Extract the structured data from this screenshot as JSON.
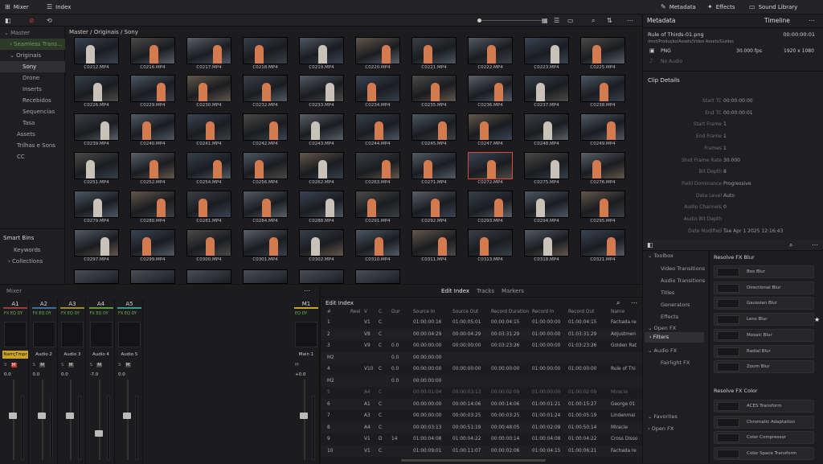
{
  "topbar": {
    "mixer": "Mixer",
    "index": "Index",
    "metadata": "Metadata",
    "effects": "Effects",
    "sound_library": "Sound Library"
  },
  "right_header": {
    "metadata": "Metadata",
    "timeline": "Timeline"
  },
  "left_tree": [
    "Master",
    "Seamless Trans...",
    "Originais",
    "Sony",
    "Drone",
    "Inserts",
    "Recebidos",
    "Sequencias",
    "Tasa",
    "Assets",
    "Trilhas e Sons",
    "CC"
  ],
  "smart_bins": {
    "title": "Smart Bins",
    "items": [
      "Keywords",
      "Collections"
    ]
  },
  "breadcrumb": "Master / Originais / Sony",
  "clips": [
    [
      "C0212.MP4",
      "C0216.MP4",
      "C0217.MP4",
      "C0218.MP4",
      "C0219.MP4",
      "C0220.MP4",
      "C0221.MP4",
      "C0222.MP4",
      "C0223.MP4",
      "C0225.MP4"
    ],
    [
      "C0226.MP4",
      "C0229.MP4",
      "C0230.MP4",
      "C0232.MP4",
      "C0233.MP4",
      "C0234.MP4",
      "C0235.MP4",
      "C0236.MP4",
      "C0237.MP4",
      "C0238.MP4"
    ],
    [
      "C0239.MP4",
      "C0240.MP4",
      "C0241.MP4",
      "C0242.MP4",
      "C0243.MP4",
      "C0244.MP4",
      "C0245.MP4",
      "C0247.MP4",
      "C0248.MP4",
      "C0249.MP4"
    ],
    [
      "C0251.MP4",
      "C0252.MP4",
      "C0254.MP4",
      "C0256.MP4",
      "C0262.MP4",
      "C0263.MP4",
      "C0271.MP4",
      "C0272.MP4",
      "C0275.MP4",
      "C0276.MP4"
    ],
    [
      "C0279.MP4",
      "C0280.MP4",
      "C0281.MP4",
      "C0284.MP4",
      "C0288.MP4",
      "C0291.MP4",
      "C0292.MP4",
      "C0293.MP4",
      "C0294.MP4",
      "C0295.MP4"
    ],
    [
      "C0297.MP4",
      "C0299.MP4",
      "C0300.MP4",
      "C0301.MP4",
      "C0302.MP4",
      "C0310.MP4",
      "C0311.MP4",
      "C0313.MP4",
      "C0318.MP4",
      "C0321.MP4"
    ]
  ],
  "metadata": {
    "filename": "Rule of Thirds-01.png",
    "timecode": "00:00:00:01",
    "path": "/mnt/Produção/Assets/Video Assets/Guides",
    "codec": "PNG",
    "fps": "30.000 fps",
    "resolution": "1920 x 1080",
    "audio": "No Audio",
    "section": "Clip Details",
    "details": [
      [
        "Start TC",
        "00:00:00:00"
      ],
      [
        "End TC",
        "00:00:00:01"
      ],
      [
        "Start Frame",
        "1"
      ],
      [
        "End Frame",
        "1"
      ],
      [
        "Frames",
        "1"
      ],
      [
        "Shot Frame Rate",
        "30.000"
      ],
      [
        "Bit Depth",
        "8"
      ],
      [
        "Field Dominance",
        "Progressive"
      ],
      [
        "Data Level",
        "Auto"
      ],
      [
        "Audio Channels",
        "0"
      ],
      [
        "Audio Bit Depth",
        ""
      ],
      [
        "Date Modified",
        "Tue Apr 1 2025 12:16:43"
      ]
    ]
  },
  "fx_tree": [
    "Toolbox",
    "Video Transitions",
    "Audio Transitions",
    "Titles",
    "Generators",
    "Effects",
    "Open FX",
    "Filters",
    "Audio FX",
    "Fairlight FX",
    "Favorites",
    "Open FX"
  ],
  "fx_blur": {
    "title": "Resolve FX Blur",
    "items": [
      "Box Blur",
      "Directional Blur",
      "Gaussian Blur",
      "Lens Blur",
      "Mosaic Blur",
      "Radial Blur",
      "Zoom Blur"
    ]
  },
  "fx_color": {
    "title": "Resolve FX Color",
    "items": [
      "ACES Transform",
      "Chromatic Adaptation",
      "Color Compressor",
      "Color Space Transform"
    ]
  },
  "mixer": {
    "title": "Mixer",
    "tracks": [
      "A1",
      "A2",
      "A3",
      "A4",
      "A5"
    ],
    "names": [
      "NarrçTmpr",
      "Audio 2",
      "Audio 3",
      "Audio 4",
      "Audio 5"
    ],
    "levels": [
      "0.0",
      "0.0",
      "0.0",
      "-7.0",
      "0.0"
    ],
    "main": "M1",
    "main_name": "Main 1",
    "main_level": "+0.0"
  },
  "edit_tabs": [
    "Edit Index",
    "Tracks",
    "Markers"
  ],
  "edit_title": "Edit Index",
  "edit_cols": [
    "#",
    "Reel",
    "V",
    "C",
    "Dur",
    "Source In",
    "Source Out",
    "Record Duration",
    "Record In",
    "Record Out",
    "Name"
  ],
  "edit_rows": [
    [
      "1",
      "",
      "V1",
      "C",
      "",
      "01:00:00:16",
      "01:00:05:01",
      "00:00:04:15",
      "01:00:00:00",
      "01:00:04:15",
      "Fachada re"
    ],
    [
      "2",
      "",
      "V8",
      "C",
      "",
      "00:00:04:29",
      "00:00:04:29",
      "00:03:31:29",
      "01:00:00:00",
      "01:03:31:29",
      "Adjustmen"
    ],
    [
      "3",
      "",
      "V9",
      "C",
      "0.0",
      "00:00:00:00",
      "00:00:00:00",
      "00:03:23:26",
      "01:00:00:00",
      "01:03:23:26",
      "Golden Rat"
    ],
    [
      "M2",
      "",
      "",
      "",
      "0.0",
      "00:00:00:00",
      "",
      "",
      "",
      "",
      ""
    ],
    [
      "4",
      "",
      "V10",
      "C",
      "0.0",
      "00:00:00:00",
      "00:00:00:00",
      "00:00:00:00",
      "01:00:00:00",
      "01:00:00:00",
      "Rule of Thi"
    ],
    [
      "M2",
      "",
      "",
      "",
      "0.0",
      "00:00:00:00",
      "",
      "",
      "",
      "",
      ""
    ],
    [
      "5",
      "",
      "A4",
      "C",
      "",
      "00:00:01:04",
      "00:00:03:13",
      "00:00:02:09",
      "01:00:00:00",
      "01:00:02:09",
      "Miracle"
    ],
    [
      "6",
      "",
      "A1",
      "C",
      "",
      "00:00:00:00",
      "00:00:14:06",
      "00:00:14:06",
      "01:00:01:21",
      "01:00:15:27",
      "George 01"
    ],
    [
      "7",
      "",
      "A3",
      "C",
      "",
      "00:00:00:00",
      "00:00:03:25",
      "00:00:03:25",
      "01:00:01:24",
      "01:00:05:19",
      "Lindenmai"
    ],
    [
      "8",
      "",
      "A4",
      "C",
      "",
      "00:00:03:13",
      "00:00:51:19",
      "00:00:48:05",
      "01:00:02:09",
      "01:00:50:14",
      "Miracle"
    ],
    [
      "9",
      "",
      "V1",
      "D",
      "14",
      "01:00:04:08",
      "01:00:04:22",
      "00:00:00:14",
      "01:00:04:08",
      "01:00:04:22",
      "Cross Disso"
    ],
    [
      "10",
      "",
      "V1",
      "C",
      "",
      "01:00:09:01",
      "01:00:11:07",
      "00:00:02:06",
      "01:00:04:15",
      "01:00:06:21",
      "Fachada re"
    ]
  ]
}
